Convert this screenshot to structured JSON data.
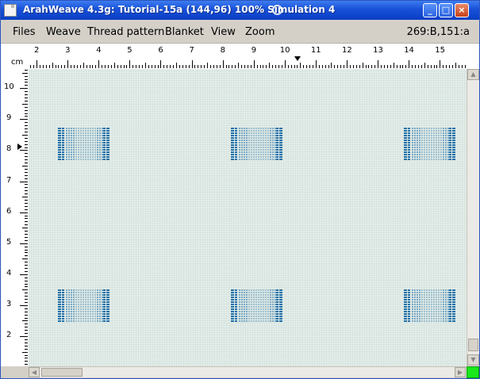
{
  "window": {
    "title": "ArahWeave 4.3g: Tutorial-15a (144,96) 100% Simulation 4"
  },
  "menu": {
    "items": [
      {
        "id": "files",
        "label": "Files"
      },
      {
        "id": "weave",
        "label": "Weave"
      },
      {
        "id": "thread-pattern",
        "label": "Thread pattern"
      },
      {
        "id": "blanket",
        "label": "Blanket"
      },
      {
        "id": "view",
        "label": "View"
      },
      {
        "id": "zoom",
        "label": "Zoom"
      }
    ],
    "coordinates": "269:B,151:a"
  },
  "ruler": {
    "unit": "cm",
    "top_labels": [
      "2",
      "3",
      "4",
      "5",
      "6",
      "7",
      "8",
      "9",
      "10",
      "11",
      "12",
      "13",
      "14",
      "15"
    ],
    "left_labels": [
      "10",
      "9",
      "8",
      "7",
      "6",
      "5",
      "4",
      "3",
      "2"
    ]
  },
  "fabric": {
    "background_color": "#e3ede9",
    "motif_color": "#1f6fa8",
    "motif_count": 6
  },
  "status_indicator_color": "#19e81a"
}
